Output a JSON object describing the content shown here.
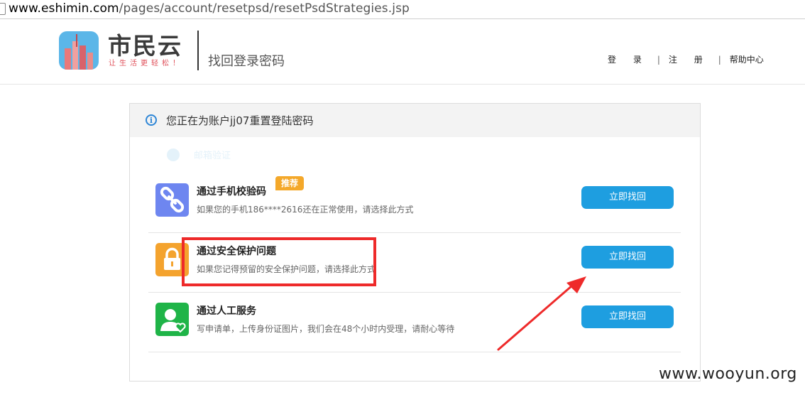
{
  "address_bar": {
    "host": "www.eshimin.com",
    "path": "/pages/account/resetpsd/resetPsdStrategies.jsp"
  },
  "header": {
    "logo_text": "市民云",
    "logo_slogan": "让生活更轻松！",
    "page_title": "找回登录密码",
    "links": {
      "login": "登 录",
      "register": "注 册",
      "help": "帮助中心"
    }
  },
  "notice": {
    "prefix": "您正在为账户",
    "account": "jj07",
    "suffix": "重置登陆密码"
  },
  "ghost_text": "邮箱验证",
  "options": [
    {
      "title": "通过手机校验码",
      "badge": "推荐",
      "description": "如果您的手机186****2616还在正常使用，请选择此方式",
      "button": "立即找回",
      "icon": "link-icon",
      "icon_color": "#6e86f0"
    },
    {
      "title": "通过安全保护问题",
      "description": "如果您记得预留的安全保护问题，请选择此方式",
      "button": "立即找回",
      "icon": "lock-icon",
      "icon_color": "#f4a32e"
    },
    {
      "title": "通过人工服务",
      "description": "写申请单，上传身份证图片，我们会在48个小时内受理，请耐心等待",
      "button": "立即找回",
      "icon": "user-heart-icon",
      "icon_color": "#1fb448"
    }
  ],
  "annotation_color": "#ee2a2a",
  "accent_color": "#1e9ee0",
  "watermark": "www.wooyun.org"
}
